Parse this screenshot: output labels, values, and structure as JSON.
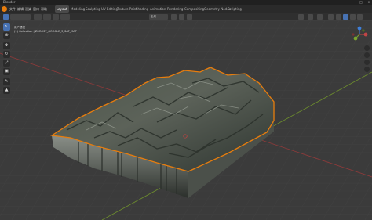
{
  "window": {
    "title": "Blender"
  },
  "menu": {
    "items": [
      "文件",
      "编辑",
      "渲染",
      "窗口",
      "帮助"
    ],
    "workspaces": [
      "Layout",
      "Modeling",
      "Sculpting",
      "UV Editing",
      "Texture Paint",
      "Shading",
      "Animation",
      "Rendering",
      "Compositing",
      "Geometry Nodes",
      "Scripting"
    ],
    "active_workspace": "Layout"
  },
  "viewport": {
    "view_name": "用户透视",
    "collection": "(1) Collection | ZOROST_GOOGLE_3_SAT_MAP",
    "transform_label": "全局"
  },
  "colors": {
    "accent": "#e87d0d",
    "active_tool": "#4772b3",
    "axis_x": "#8b3a3a",
    "axis_y": "#6b8a2e",
    "background": "#3b3b3b"
  }
}
